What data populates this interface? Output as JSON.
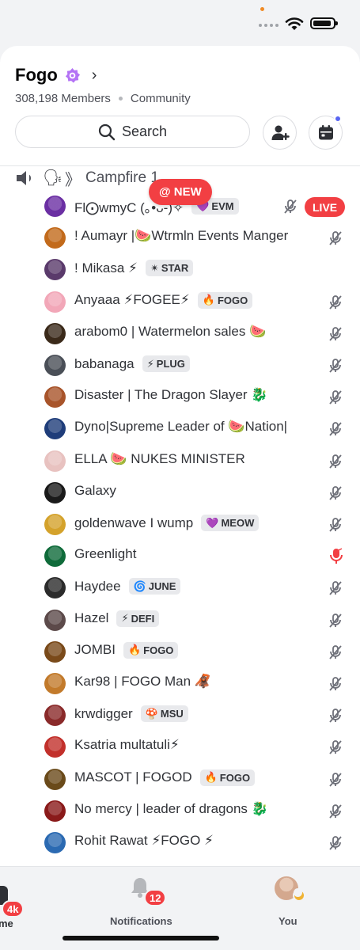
{
  "server": {
    "name": "Fogo",
    "members": "308,198 Members",
    "type": "Community"
  },
  "search": {
    "label": "Search"
  },
  "channel": {
    "name": "Campfire 1"
  },
  "new_pill": {
    "label": "@ NEW"
  },
  "members": [
    {
      "name": "Fl⨀wmyC (｡•̀ᴗ-)✧",
      "tag": "EVM",
      "tag_icon": "💜",
      "status": "live",
      "live_label": "LIVE",
      "avatar_color": "#6b2fa3"
    },
    {
      "name": "! Aumayr |🍉Wtrmln Events Manger",
      "tag": "",
      "status": "muted",
      "avatar_color": "#c26a1b"
    },
    {
      "name": "! Mikasa ⚡",
      "tag": "STAR",
      "tag_icon": "✴",
      "status": "none",
      "avatar_color": "#5a3a6b"
    },
    {
      "name": "Anyaaa ⚡FOGEE⚡",
      "tag": "FOGO",
      "tag_icon": "🔥",
      "status": "muted",
      "avatar_color": "#f2a7b8"
    },
    {
      "name": "arabom0 | Watermelon sales 🍉",
      "tag": "",
      "status": "muted",
      "avatar_color": "#3b2a1a"
    },
    {
      "name": "babanaga",
      "tag": "PLUG",
      "tag_icon": "⚡",
      "status": "muted",
      "avatar_color": "#4a4f57"
    },
    {
      "name": "Disaster | The Dragon Slayer 🐉",
      "tag": "",
      "status": "muted",
      "avatar_color": "#a8542a"
    },
    {
      "name": "Dyno|Supreme Leader of 🍉Nation|",
      "tag": "",
      "status": "muted",
      "avatar_color": "#1f3d7a"
    },
    {
      "name": "ELLA 🍉 NUKES MINISTER",
      "tag": "",
      "status": "muted",
      "avatar_color": "#e8c2c0"
    },
    {
      "name": "Galaxy",
      "tag": "",
      "status": "muted",
      "avatar_color": "#1a1a1a"
    },
    {
      "name": "goldenwave I wump",
      "tag": "MEOW",
      "tag_icon": "💜",
      "status": "muted",
      "avatar_color": "#d4a22b"
    },
    {
      "name": "Greenlight",
      "tag": "",
      "status": "mic",
      "avatar_color": "#0f6b3a"
    },
    {
      "name": "Haydee",
      "tag": "JUNE",
      "tag_icon": "🌀",
      "status": "muted",
      "avatar_color": "#2b2b2b"
    },
    {
      "name": "Hazel",
      "tag": "DEFI",
      "tag_icon": "⚡",
      "status": "muted",
      "avatar_color": "#5c4a4a"
    },
    {
      "name": "JOMBI",
      "tag": "FOGO",
      "tag_icon": "🔥",
      "status": "muted",
      "avatar_color": "#7a4a1a"
    },
    {
      "name": "Kar98 | FOGO Man 🦧",
      "tag": "",
      "status": "muted",
      "avatar_color": "#c27a2b"
    },
    {
      "name": "krwdigger",
      "tag": "MSU",
      "tag_icon": "🍄",
      "status": "muted",
      "avatar_color": "#8a2a2a"
    },
    {
      "name": "Ksatria multatuli⚡",
      "tag": "",
      "status": "muted",
      "avatar_color": "#c2302b"
    },
    {
      "name": "MASCOT | FOGOD",
      "tag": "FOGO",
      "tag_icon": "🔥",
      "status": "muted",
      "avatar_color": "#6a4a1a"
    },
    {
      "name": "No mercy | leader of dragons 🐉",
      "tag": "",
      "status": "muted",
      "avatar_color": "#8a1a1a"
    },
    {
      "name": "Rohit Rawat ⚡FOGO ⚡",
      "tag": "",
      "status": "muted",
      "avatar_color": "#2b6ab2"
    }
  ],
  "nav": {
    "home_label": "me",
    "home_badge": "4k",
    "notifications_label": "Notifications",
    "notifications_badge": "12",
    "you_label": "You"
  },
  "colors": {
    "accent_red": "#f23f43",
    "blurple": "#5865f2",
    "boost_purple": "#b473f5"
  }
}
